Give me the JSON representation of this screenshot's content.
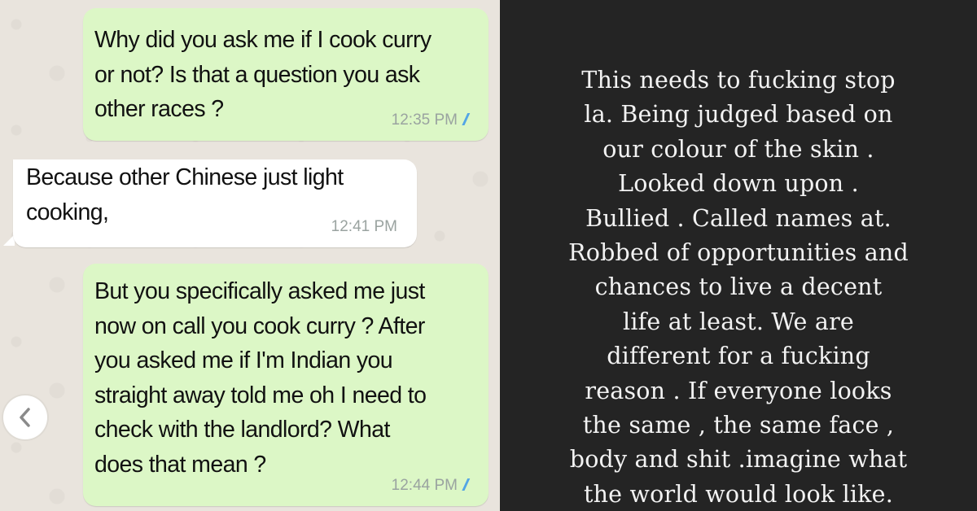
{
  "chat": {
    "messages": [
      {
        "direction": "outgoing",
        "text": "Why did you ask me if I cook curry\nor not? Is that a question you ask\nother races ?",
        "time": "12:35 PM",
        "status": "read"
      },
      {
        "direction": "incoming",
        "text": "Because other Chinese just light\ncooking,",
        "time": "12:41 PM"
      },
      {
        "direction": "outgoing",
        "text": "But you specifically asked me just\nnow on call you cook curry ? After\nyou asked me if I'm Indian you\nstraight away told me oh I need to\ncheck with the landlord? What\ndoes that mean ?",
        "time": "12:44 PM",
        "status": "read"
      }
    ],
    "back_icon": "chevron-left-icon",
    "colors": {
      "outgoing_bubble": "#dcf7c6",
      "incoming_bubble": "#ffffff",
      "read_ticks": "#4fa3e6",
      "wallpaper": "#e9e4dd"
    }
  },
  "story": {
    "text": "This needs to fucking stop\nla.  Being judged based on\nour colour of the skin .\nLooked down upon .\nBullied . Called names at.\nRobbed of opportunities and\nchances to live a decent\nlife at least. We are\ndifferent for a fucking\nreason . If everyone looks\nthe same , the same face ,\nbody and shit .imagine what\nthe world would look like.",
    "colors": {
      "background": "#242424",
      "text": "#f2f2f2"
    }
  }
}
